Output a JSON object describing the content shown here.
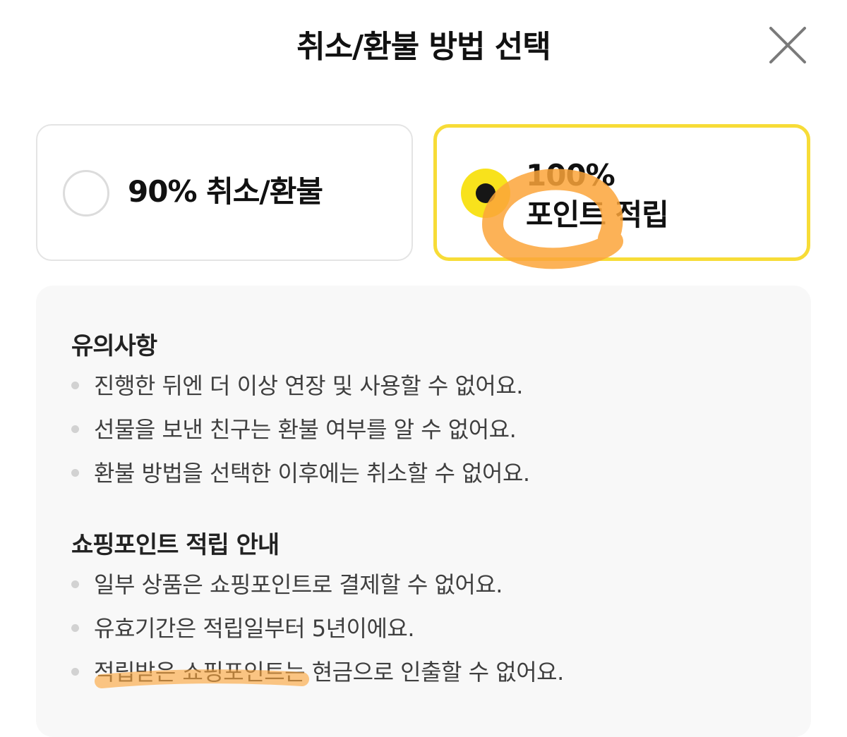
{
  "modal": {
    "title": "취소/환불 방법 선택",
    "close_icon": "close-icon"
  },
  "options": [
    {
      "label": "90% 취소/환불",
      "selected": false
    },
    {
      "label_line1": "100%",
      "label_line2": "포인트 적립",
      "selected": true
    }
  ],
  "colors": {
    "accent_yellow": "#f8e21c",
    "selected_border": "#f7dc37",
    "highlighter_orange": "#fba43a"
  },
  "notices": {
    "title": "유의사항",
    "items": [
      "진행한 뒤엔 더 이상 연장 및 사용할 수 없어요.",
      "선물을 보낸 친구는 환불 여부를 알 수 없어요.",
      "환불 방법을 선택한 이후에는 취소할 수 없어요."
    ]
  },
  "points_guide": {
    "title": "쇼핑포인트 적립 안내",
    "items": [
      "일부 상품은 쇼핑포인트로 결제할 수 없어요.",
      "유효기간은 적립일부터 5년이에요.",
      "적립받은 쇼핑포인트는 현금으로 인출할 수 없어요."
    ]
  }
}
